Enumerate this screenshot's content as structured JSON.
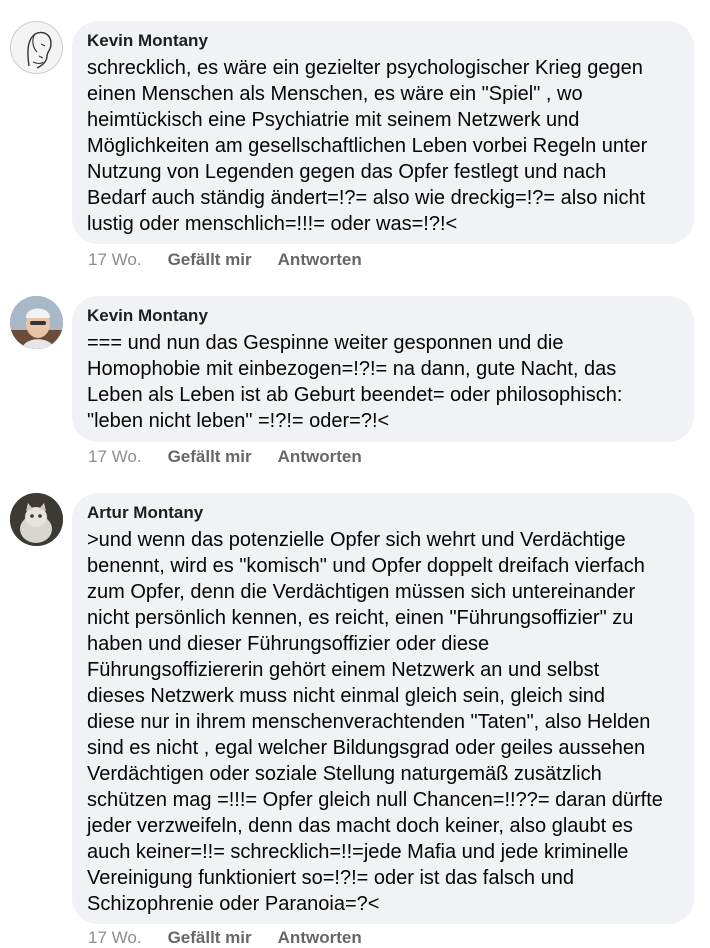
{
  "comments": [
    {
      "author": "Kevin Montany",
      "text": "schrecklich, es wäre ein gezielter psychologischer Krieg gegen\neinen Menschen als Menschen, es wäre ein \"Spiel\" , wo\nheimtückisch eine Psychiatrie mit seinem Netzwerk und\nMöglichkeiten am gesellschaftlichen Leben vorbei Regeln unter\nNutzung von Legenden gegen das Opfer festlegt und nach\nBedarf auch ständig ändert=!?= also wie dreckig=!?= also nicht\nlustig oder menschlich=!!!= oder was=!?!<",
      "time": "17 Wo.",
      "like": "Gefällt mir",
      "reply": "Antworten"
    },
    {
      "author": "Kevin Montany",
      "text": "=== und nun das Gespinne weiter gesponnen und die\nHomophobie mit einbezogen=!?!= na dann, gute Nacht, das\nLeben als Leben ist ab Geburt beendet= oder philosophisch:\n\"leben nicht leben\" =!?!= oder=?!<",
      "time": "17 Wo.",
      "like": "Gefällt mir",
      "reply": "Antworten"
    },
    {
      "author": "Artur Montany",
      "text": ">und wenn das potenzielle Opfer sich wehrt und Verdächtige\nbenennt, wird es \"komisch\" und Opfer doppelt dreifach vierfach\nzum Opfer, denn die Verdächtigen müssen sich untereinander\nnicht persönlich kennen, es reicht, einen \"Führungsoffizier\" zu\nhaben und dieser Führungsoffizier oder diese\nFührungsoffiziererin gehört einem Netzwerk an und selbst\ndieses Netzwerk muss nicht einmal gleich sein, gleich sind\ndiese nur in ihrem menschenverachtenden \"Taten\", also Helden\nsind es nicht , egal welcher Bildungsgrad oder geiles aussehen\nVerdächtigen oder soziale Stellung naturgemäß zusätzlich\nschützen mag =!!!= Opfer gleich null Chancen=!!??= daran dürfte\njeder verzweifeln, denn das macht doch keiner, also glaubt es\nauch keiner=!!= schrecklich=!!=jede Mafia und jede kriminelle\nVereinigung funktioniert so=!?!= oder ist das falsch und\nSchizophrenie oder Paranoia=?<",
      "time": "17 Wo.",
      "like": "Gefällt mir",
      "reply": "Antworten"
    }
  ]
}
